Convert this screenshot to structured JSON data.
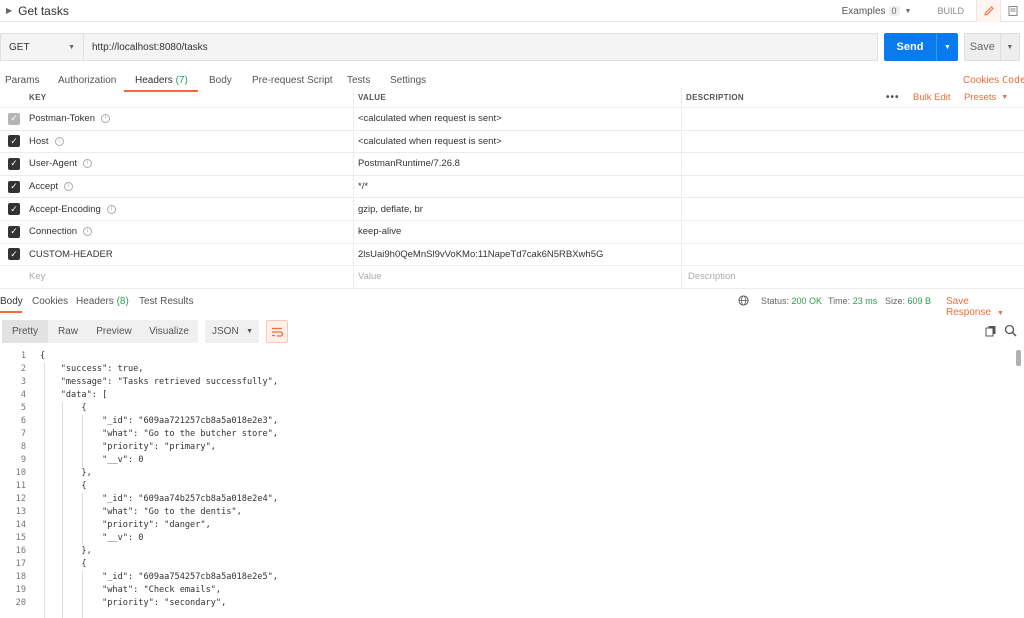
{
  "titlebar": {
    "title": "Get tasks",
    "examples_label": "Examples",
    "examples_count": "0",
    "build_label": "BUILD"
  },
  "request": {
    "method": "GET",
    "url": "http://localhost:8080/tasks",
    "send_label": "Send",
    "save_label": "Save"
  },
  "request_tabs": {
    "params": "Params",
    "authorization": "Authorization",
    "headers": "Headers",
    "headers_count": "(7)",
    "body": "Body",
    "prerequest": "Pre-request Script",
    "tests": "Tests",
    "settings": "Settings",
    "cookies": "Cookies",
    "code": "Code"
  },
  "headers_table": {
    "col_key": "KEY",
    "col_value": "VALUE",
    "col_description": "DESCRIPTION",
    "more": "•••",
    "bulk_edit": "Bulk Edit",
    "presets": "Presets",
    "rows": [
      {
        "key": "Postman-Token",
        "value": "<calculated when request is sent>",
        "info": true,
        "checked": true,
        "disabled": true
      },
      {
        "key": "Host",
        "value": "<calculated when request is sent>",
        "info": true,
        "checked": true,
        "disabled": false
      },
      {
        "key": "User-Agent",
        "value": "PostmanRuntime/7.26.8",
        "info": true,
        "checked": true,
        "disabled": false
      },
      {
        "key": "Accept",
        "value": "*/*",
        "info": true,
        "checked": true,
        "disabled": false
      },
      {
        "key": "Accept-Encoding",
        "value": "gzip, deflate, br",
        "info": true,
        "checked": true,
        "disabled": false
      },
      {
        "key": "Connection",
        "value": "keep-alive",
        "info": true,
        "checked": true,
        "disabled": false
      },
      {
        "key": "CUSTOM-HEADER",
        "value": "2lsUai9h0QeMnSl9vVoKMo:11NapeTd7cak6N5RBXwh5G",
        "info": false,
        "checked": true,
        "disabled": false
      }
    ],
    "placeholder_key": "Key",
    "placeholder_value": "Value",
    "placeholder_description": "Description"
  },
  "response_tabs": {
    "body": "Body",
    "cookies": "Cookies",
    "headers": "Headers",
    "headers_count": "(8)",
    "test_results": "Test Results",
    "status_label": "Status:",
    "status_value": "200 OK",
    "time_label": "Time:",
    "time_value": "23 ms",
    "size_label": "Size:",
    "size_value": "609 B",
    "save_response": "Save Response"
  },
  "body_toolbar": {
    "pretty": "Pretty",
    "raw": "Raw",
    "preview": "Preview",
    "visualize": "Visualize",
    "format": "JSON"
  },
  "code_lines": [
    "{",
    "    \"success\": true,",
    "    \"message\": \"Tasks retrieved successfully\",",
    "    \"data\": [",
    "        {",
    "            \"_id\": \"609aa721257cb8a5a018e2e3\",",
    "            \"what\": \"Go to the butcher store\",",
    "            \"priority\": \"primary\",",
    "            \"__v\": 0",
    "        },",
    "        {",
    "            \"_id\": \"609aa74b257cb8a5a018e2e4\",",
    "            \"what\": \"Go to the dentis\",",
    "            \"priority\": \"danger\",",
    "            \"__v\": 0",
    "        },",
    "        {",
    "            \"_id\": \"609aa754257cb8a5a018e2e5\",",
    "            \"what\": \"Check emails\",",
    "            \"priority\": \"secondary\","
  ]
}
